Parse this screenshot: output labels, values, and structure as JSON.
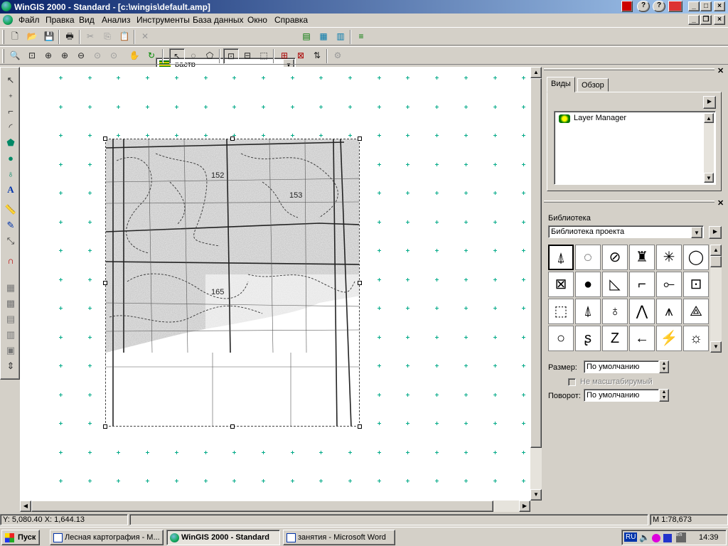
{
  "window": {
    "title": "WinGIS 2000 - Standard - [c:\\wingis\\default.amp]"
  },
  "menu": {
    "items": [
      "Файл",
      "Правка",
      "Вид",
      "Анализ",
      "Инструменты",
      "База данных",
      "Окно",
      "Справка"
    ]
  },
  "toolbar": {
    "layer_value": "растр"
  },
  "right_panel": {
    "tabs": [
      "Виды",
      "Обзор"
    ],
    "views_items": [
      "Layer Manager"
    ],
    "library_label": "Библиотека",
    "library_value": "Библиотека проекта",
    "size_label": "Размер:",
    "size_value": "По умолчанию",
    "not_scalable_label": "Не масштабирумый",
    "rotation_label": "Поворот:",
    "rotation_value": "По умолчанию"
  },
  "map": {
    "labels": [
      "152",
      "153",
      "165"
    ]
  },
  "status": {
    "coords": "Y: 5,080.40 X: 1,644.13",
    "scale": "M 1:78,673"
  },
  "taskbar": {
    "start_label": "Пуск",
    "tasks": [
      "Лесная картография - M...",
      "WinGIS 2000 - Standard",
      "занятия - Microsoft Word"
    ],
    "lang": "RU",
    "clock": "14:39"
  },
  "colors": {
    "title_start": "#0a246a",
    "title_end": "#a6caf0",
    "grid_cross": "#00aa88"
  }
}
